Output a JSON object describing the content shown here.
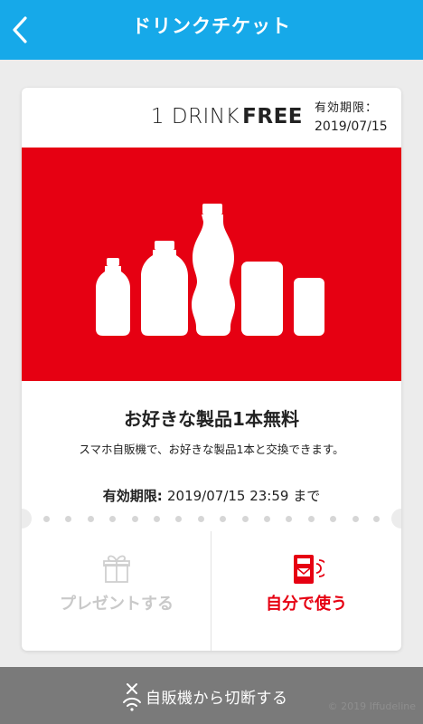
{
  "header": {
    "title": "ドリンクチケット",
    "bg_color": "#16a9e9"
  },
  "ticket": {
    "drink_prefix": "1 DRINK",
    "drink_bold": "FREE",
    "validity_label": "有効期限：",
    "validity_date": "2019/07/15",
    "hero_color": "#e60012",
    "product_title": "お好きな製品1本無料",
    "product_desc": "スマホ自販機で、お好きな製品1本と交換できます。",
    "expiry_label": "有効期限:",
    "expiry_value": "2019/07/15 23:59 まで"
  },
  "actions": {
    "present_label": "プレゼントする",
    "use_label": "自分で使う"
  },
  "footer": {
    "disconnect_label": "自販機から切断する",
    "copyright": "© 2019 Iffudeline"
  }
}
